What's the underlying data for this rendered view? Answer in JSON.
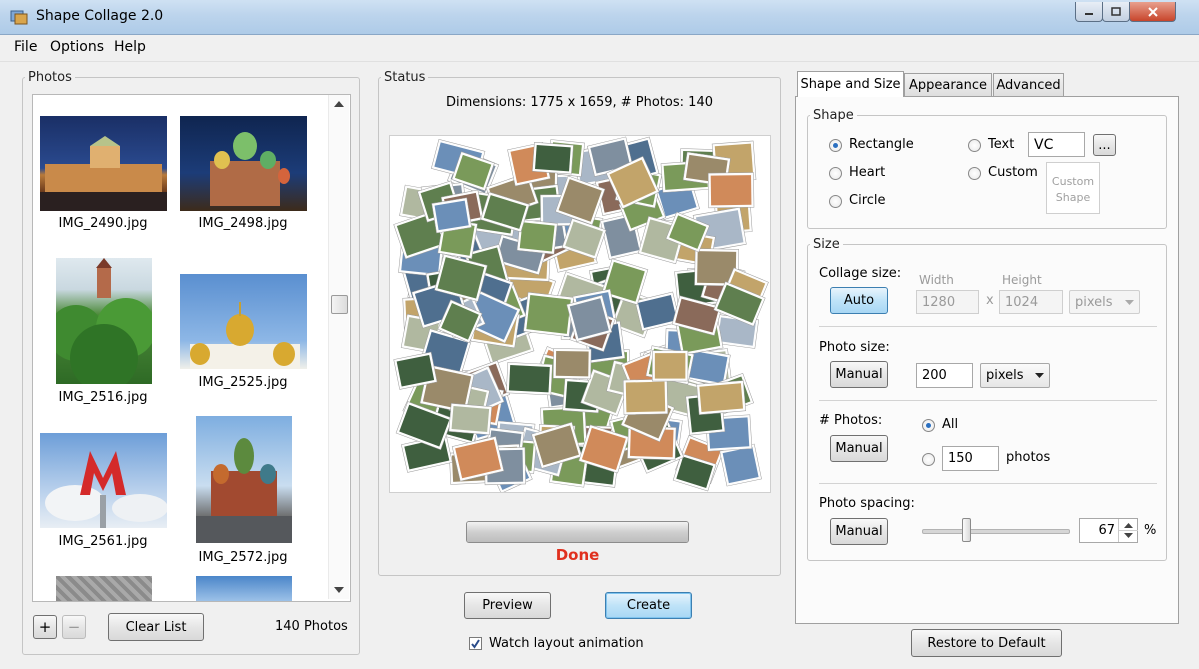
{
  "window": {
    "title": "Shape Collage 2.0"
  },
  "menu": {
    "items": [
      "File",
      "Options",
      "Help"
    ]
  },
  "photos": {
    "group_label": "Photos",
    "items": [
      {
        "name": "IMG_2490.jpg"
      },
      {
        "name": "IMG_2498.jpg"
      },
      {
        "name": "IMG_2516.jpg"
      },
      {
        "name": "IMG_2525.jpg"
      },
      {
        "name": "IMG_2561.jpg"
      },
      {
        "name": "IMG_2572.jpg"
      }
    ],
    "add_label": "+",
    "remove_label": "−",
    "clear_label": "Clear List",
    "count_label": "140 Photos"
  },
  "status": {
    "group_label": "Status",
    "dimensions_text": "Dimensions: 1775 x 1659, # Photos: 140",
    "progress": 1.0,
    "done_text": "Done",
    "preview_label": "Preview",
    "create_label": "Create",
    "watch_label": "Watch layout animation",
    "watch_checked": true
  },
  "tabs": [
    "Shape and Size",
    "Appearance",
    "Advanced"
  ],
  "shape": {
    "group_label": "Shape",
    "rectangle": "Rectangle",
    "heart": "Heart",
    "circle": "Circle",
    "text": "Text",
    "text_value": "VC",
    "browse_label": "...",
    "custom": "Custom",
    "custom_shape_line1": "Custom",
    "custom_shape_line2": "Shape",
    "selected": "Rectangle"
  },
  "size": {
    "group_label": "Size",
    "collage_size_label": "Collage size:",
    "auto_label": "Auto",
    "width_label": "Width",
    "height_label": "Height",
    "width_value": "1280",
    "x_label": "x",
    "height_value": "1024",
    "units_value": "pixels",
    "photo_size_label": "Photo size:",
    "photo_size_mode": "Manual",
    "photo_size_value": "200",
    "photo_size_units": "pixels",
    "num_photos_label": "# Photos:",
    "num_photos_mode": "Manual",
    "all_label": "All",
    "num_value": "150",
    "photos_label": "photos",
    "spacing_label": "Photo spacing:",
    "spacing_mode": "Manual",
    "spacing_value": "67",
    "percent_label": "%"
  },
  "restore_label": "Restore to Default",
  "colors": {
    "done": "#e0301e",
    "accent_blue": "#2a6fc0"
  }
}
